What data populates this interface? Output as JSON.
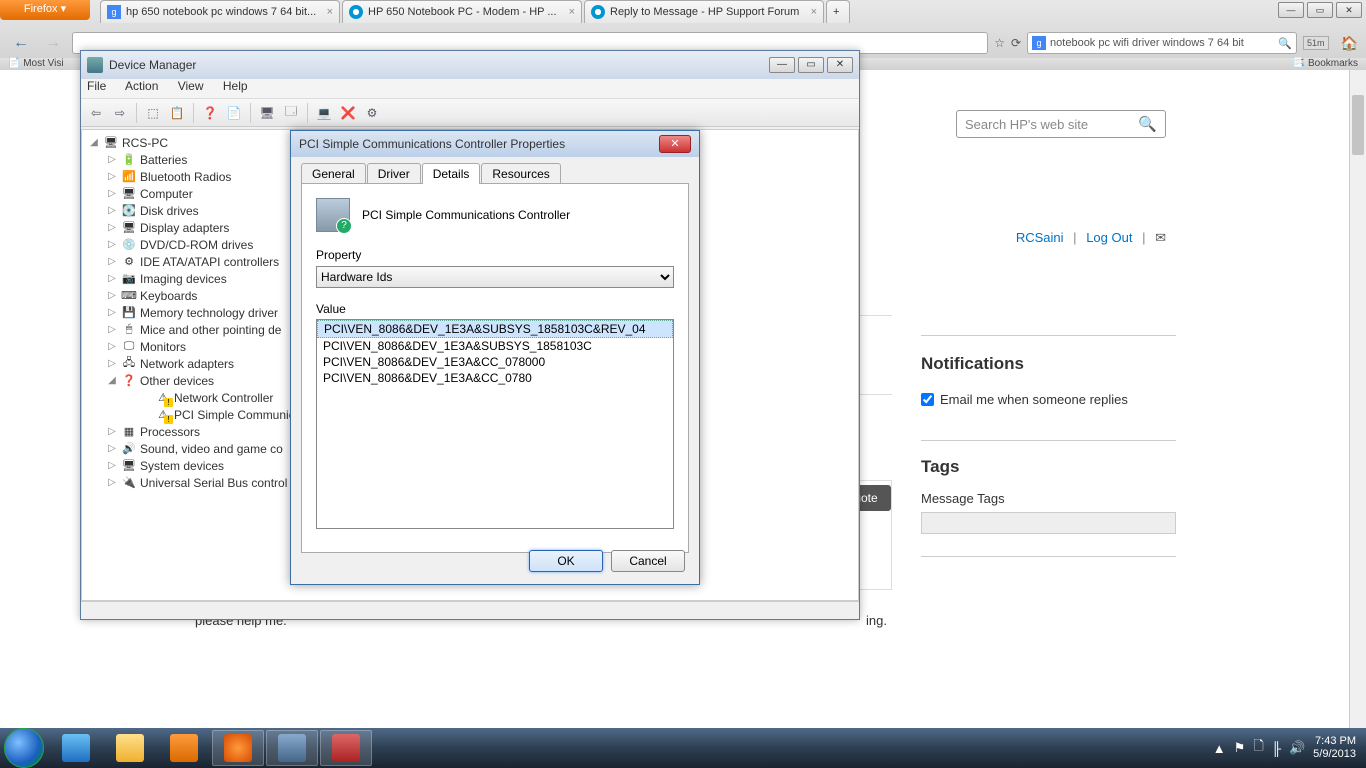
{
  "browser": {
    "firefox_button": "Firefox ▾",
    "tabs": [
      {
        "label": "hp 650 notebook pc windows 7 64 bit...",
        "favicon": "google"
      },
      {
        "label": "HP 650 Notebook PC -  Modem - HP ...",
        "favicon": "hp"
      },
      {
        "label": "Reply to Message - HP Support Forum",
        "favicon": "hp"
      }
    ],
    "window_controls": {
      "min": "—",
      "max": "▭",
      "close": "✕"
    },
    "nav": {
      "back": "←",
      "forward": "→"
    },
    "urlbar": "                                                                                 ",
    "url_star": "☆",
    "reload": "⟳",
    "search_placeholder": "notebook pc wifi driver windows 7 64 bit",
    "search_mag": "🔍",
    "badge": "51m",
    "home": "🏠",
    "bookmarks_left": "📄 Most Visi",
    "bookmarks_right": "📑 Bookmarks"
  },
  "page": {
    "search_placeholder": "Search HP's web site",
    "username": "RCSaini",
    "logout": "Log Out",
    "mail_icon": "✉",
    "notifications_h": "Notifications",
    "notif_cb": "Email me when someone replies",
    "tags_h": "Tags",
    "tags_label": "Message Tags",
    "quote": "uote",
    "partial_right": "ing.",
    "help": "please help me."
  },
  "devmgr": {
    "title": "Device Manager",
    "window_controls": {
      "min": "—",
      "max": "▭",
      "close": "✕"
    },
    "menu": {
      "file": "File",
      "action": "Action",
      "view": "View",
      "help": "Help"
    },
    "toolbar_icons": [
      "⇦",
      "⇨",
      "|",
      "⬚",
      "📋",
      "|",
      "❓",
      "📄",
      "|",
      "🖥",
      "🗔",
      "|",
      "💻",
      "❌",
      "⚙"
    ],
    "root": "RCS-PC",
    "categories": [
      {
        "label": "Batteries",
        "icon": "🔋"
      },
      {
        "label": "Bluetooth Radios",
        "icon": "📶"
      },
      {
        "label": "Computer",
        "icon": "🖥"
      },
      {
        "label": "Disk drives",
        "icon": "💽"
      },
      {
        "label": "Display adapters",
        "icon": "🖥"
      },
      {
        "label": "DVD/CD-ROM drives",
        "icon": "💿"
      },
      {
        "label": "IDE ATA/ATAPI controllers",
        "icon": "⚙"
      },
      {
        "label": "Imaging devices",
        "icon": "📷"
      },
      {
        "label": "Keyboards",
        "icon": "⌨"
      },
      {
        "label": "Memory technology driver",
        "icon": "💾"
      },
      {
        "label": "Mice and other pointing de",
        "icon": "🖱"
      },
      {
        "label": "Monitors",
        "icon": "🖵"
      },
      {
        "label": "Network adapters",
        "icon": "🖧"
      }
    ],
    "other_devices": {
      "label": "Other devices",
      "icon": "❓",
      "children": [
        {
          "label": "Network Controller",
          "icon": "⚠"
        },
        {
          "label": "PCI Simple Communica",
          "icon": "⚠"
        }
      ]
    },
    "more_categories": [
      {
        "label": "Processors",
        "icon": "▦"
      },
      {
        "label": "Sound, video and game co",
        "icon": "🔊"
      },
      {
        "label": "System devices",
        "icon": "🖥"
      },
      {
        "label": "Universal Serial Bus control",
        "icon": "🔌"
      }
    ]
  },
  "propdlg": {
    "title": "PCI Simple Communications Controller Properties",
    "close": "✕",
    "tabs": {
      "general": "General",
      "driver": "Driver",
      "details": "Details",
      "resources": "Resources"
    },
    "device_name": "PCI Simple Communications Controller",
    "property_label": "Property",
    "property_value": "Hardware Ids",
    "value_label": "Value",
    "values": [
      "PCI\\VEN_8086&DEV_1E3A&SUBSYS_1858103C&REV_04",
      "PCI\\VEN_8086&DEV_1E3A&SUBSYS_1858103C",
      "PCI\\VEN_8086&DEV_1E3A&CC_078000",
      "PCI\\VEN_8086&DEV_1E3A&CC_0780"
    ],
    "ok": "OK",
    "cancel": "Cancel"
  },
  "taskbar": {
    "items": [
      {
        "name": "start",
        "color": ""
      },
      {
        "name": "ie",
        "bg": "linear-gradient(#6ac0f4,#1e6fc0)"
      },
      {
        "name": "explorer",
        "bg": "linear-gradient(#ffe08a,#f0b030)"
      },
      {
        "name": "wmp",
        "bg": "linear-gradient(#ff9a3c,#d86a00)"
      },
      {
        "name": "firefox",
        "bg": "radial-gradient(circle,#ff9a3c,#d84a00)",
        "active": true
      },
      {
        "name": "devmgr",
        "bg": "linear-gradient(#8ac,#468)",
        "active": true
      },
      {
        "name": "toolbox",
        "bg": "linear-gradient(#d66,#a22)",
        "active": true
      }
    ],
    "tray": {
      "up": "▲",
      "flag": "⚑",
      "batt": "🗋",
      "net": "╟",
      "vol": "🔊",
      "time": "7:43 PM",
      "date": "5/9/2013"
    }
  }
}
